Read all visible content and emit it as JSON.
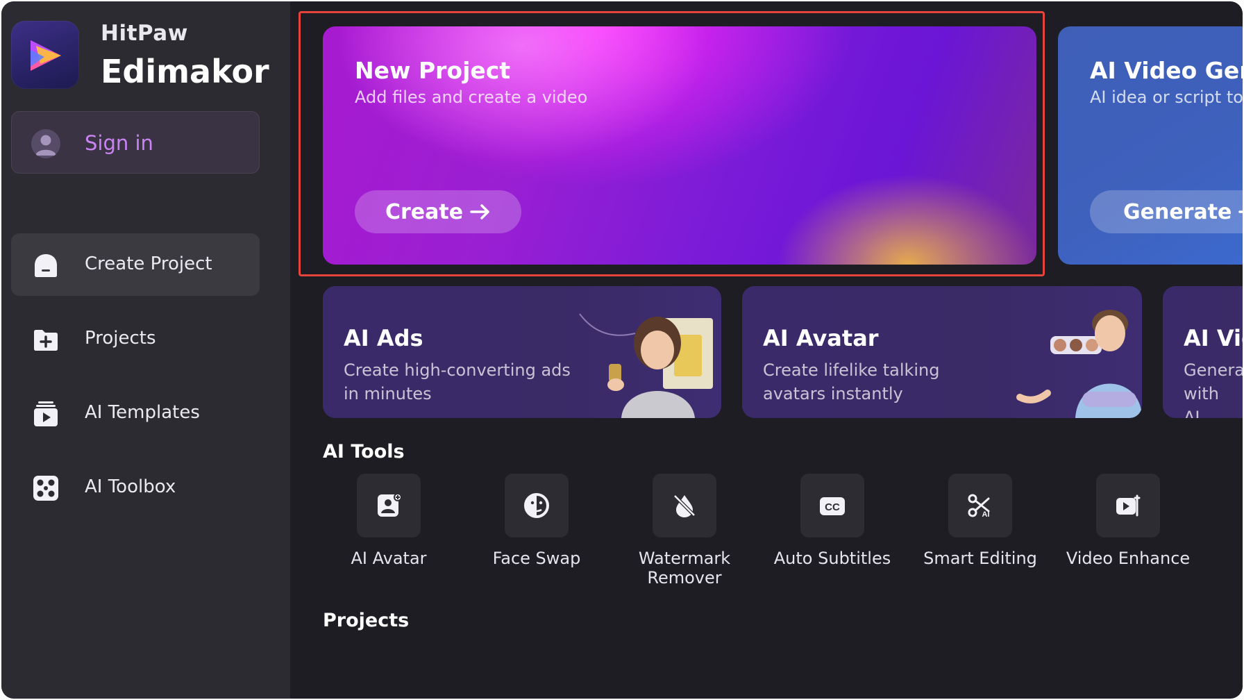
{
  "brand": {
    "top": "HitPaw",
    "main": "Edimakor"
  },
  "signin": {
    "label": "Sign in"
  },
  "nav": [
    {
      "label": "Create Project",
      "icon": "home-icon",
      "active": true
    },
    {
      "label": "Projects",
      "icon": "folder-plus-icon"
    },
    {
      "label": "AI Templates",
      "icon": "play-stack-icon"
    },
    {
      "label": "AI Toolbox",
      "icon": "toolbox-icon"
    }
  ],
  "new_project": {
    "title": "New Project",
    "subtitle": "Add files and create a video",
    "button": "Create",
    "button_icon": "arrow-right-icon"
  },
  "ai_video_gen": {
    "title": "AI Video Gener",
    "subtitle": "AI idea or script to v",
    "button": "Generate",
    "button_icon": "arrow-right-icon"
  },
  "features": [
    {
      "title": "AI Ads",
      "subtitle": "Create high-converting ads in minutes"
    },
    {
      "title": "AI Avatar",
      "subtitle": "Create lifelike talking avatars instantly"
    },
    {
      "title": "AI Vid",
      "subtitle": "Generat with AI"
    }
  ],
  "ai_tools": {
    "title": "AI Tools",
    "items": [
      {
        "label": "AI Avatar",
        "icon": "avatar-icon"
      },
      {
        "label": "Face Swap",
        "icon": "face-swap-icon"
      },
      {
        "label": "Watermark Remover",
        "icon": "watermark-remover-icon"
      },
      {
        "label": "Auto Subtitles",
        "icon": "cc-icon"
      },
      {
        "label": "Smart Editing",
        "icon": "scissors-ai-icon"
      },
      {
        "label": "Video Enhance",
        "icon": "video-enhance-icon"
      }
    ]
  },
  "projects": {
    "title": "Projects"
  },
  "colors": {
    "accent": "#c983f2",
    "highlight": "#e5443c",
    "sidebar": "#2c2b31",
    "main": "#1e1d23"
  }
}
